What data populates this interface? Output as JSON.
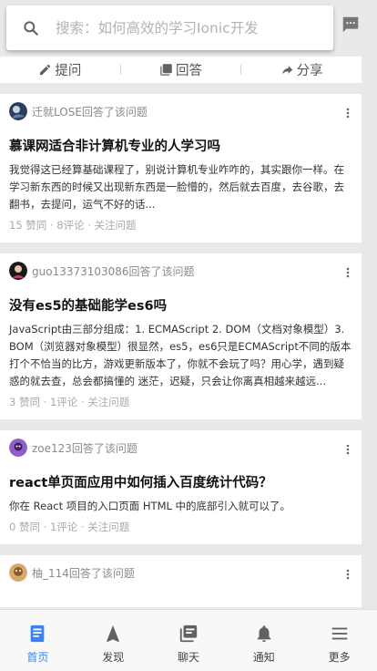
{
  "search": {
    "placeholder": "搜索：如何高效的学习Ionic开发"
  },
  "actions": [
    {
      "label": "提问",
      "icon": "pencil-icon"
    },
    {
      "label": "回答",
      "icon": "answer-icon"
    },
    {
      "label": "分享",
      "icon": "share-icon"
    }
  ],
  "feed": [
    {
      "author": "迁就LOSE回答了该问题",
      "title": "慕课网适合非计算机专业的人学习吗",
      "summary": "我觉得这已经算基础课程了，别说计算机专业咋咋的，其实跟你一样。在学习新东西的时候又出现新东西是一脸懵的，然后就去百度，去谷歌，去翻书，去提问，运气不好的话...",
      "stats": "15 赞同 · 8评论 · 关注问题"
    },
    {
      "author": "guo13373103086回答了该问题",
      "title": "没有es5的基础能学es6吗",
      "summary": "JavaScript由三部分组成：1. ECMAScript 2. DOM（文档对象模型）3. BOM（浏览器对象模型）很显然，es5，es6只是ECMAScript不同的版本 打个不恰当的比方，游戏更新版本了，你就不会玩了吗？用心学，遇到疑惑的就去查，总会都搞懂的 迷茫，迟疑，只会让你离真相越来越远...",
      "stats": "3 赞同 · 1评论 · 关注问题"
    },
    {
      "author": "zoe123回答了该问题",
      "title": "react单页面应用中如何插入百度统计代码？",
      "summary": "你在 React 项目的入口页面 HTML 中的底部引入就可以了。",
      "stats": "0 赞同 · 1评论 · 关注问题"
    },
    {
      "author": "柚_114回答了该问题",
      "title": "",
      "summary": "",
      "stats": ""
    }
  ],
  "tabs": [
    {
      "label": "首页",
      "icon": "home-icon",
      "active": true
    },
    {
      "label": "发现",
      "icon": "navigation-icon"
    },
    {
      "label": "聊天",
      "icon": "chat-icon"
    },
    {
      "label": "通知",
      "icon": "bell-icon"
    },
    {
      "label": "更多",
      "icon": "menu-icon"
    }
  ],
  "colors": {
    "accent": "#3b82f6",
    "icon_gray": "#616161"
  }
}
